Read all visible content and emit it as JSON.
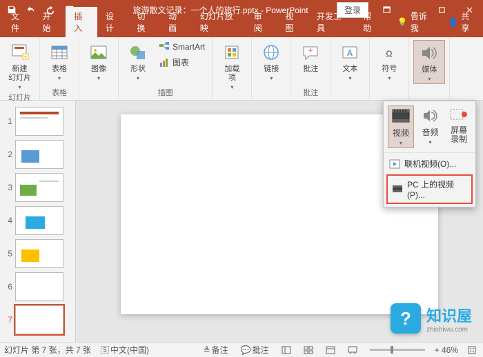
{
  "title": "旅游散文记录：一个人的旅行.pptx - PowerPoint",
  "login": "登录",
  "tabs": {
    "file": "文件",
    "home": "开始",
    "insert": "插入",
    "design": "设计",
    "transitions": "切换",
    "animations": "动画",
    "slideshow": "幻灯片放映",
    "review": "审阅",
    "view": "视图",
    "developer": "开发工具",
    "help": "帮助",
    "tellme": "告诉我",
    "share": "共享"
  },
  "ribbon": {
    "groups": {
      "slides": "幻灯片",
      "tables": "表格",
      "images_group": "",
      "illustrations": "插图",
      "addins_group": "",
      "links_group": "",
      "comments": "批注",
      "text_group": "",
      "symbols_group": "",
      "media_group": ""
    },
    "new_slide": "新建\n幻灯片",
    "table": "表格",
    "images": "图像",
    "shapes": "形状",
    "smartart": "SmartArt",
    "chart": "图表",
    "addins": "加载\n项",
    "links": "链接",
    "comment": "批注",
    "text": "文本",
    "symbols": "符号",
    "media": "媒体"
  },
  "media_popup": {
    "video": "视频",
    "audio": "音频",
    "screen_rec": "屏幕\n录制",
    "online_video": "联机视频(O)...",
    "pc_video": "PC 上的视频(P)..."
  },
  "thumbnails": [
    1,
    2,
    3,
    4,
    5,
    6,
    7
  ],
  "selected_slide": 7,
  "status": {
    "slide_info": "幻灯片 第 7 张，共 7 张",
    "lang_icon": "",
    "lang": "中文(中国)",
    "notes": "备注",
    "comments_sb": "批注",
    "zoom": "+ 46%"
  },
  "watermark": {
    "icon": "?",
    "text": "知识屋",
    "url": "zhishiwu.com"
  }
}
